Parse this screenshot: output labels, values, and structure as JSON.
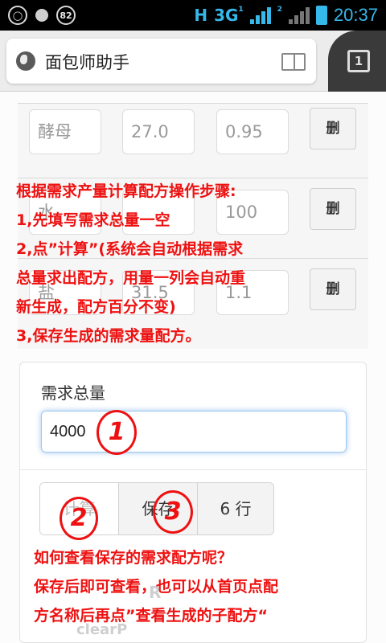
{
  "status_bar": {
    "left_badge": "82",
    "network_h": "H",
    "network_3g": "3G",
    "sim1": "1",
    "sim2": "2",
    "time": "20:37"
  },
  "browser": {
    "title": "面包师助手",
    "tab_count": "1"
  },
  "ingredients": [
    {
      "name": "酵母",
      "amount": "27.0",
      "percent": "0.95",
      "delete_label": "删"
    },
    {
      "name": "水",
      "amount": "",
      "percent": "100",
      "delete_label": "删"
    },
    {
      "name": "盐",
      "amount": "31.5",
      "percent": "1.1",
      "delete_label": "删"
    }
  ],
  "total": {
    "label": "需求总量",
    "value": "4000"
  },
  "buttons": {
    "calc": "计算",
    "save": "保存",
    "rows": "6 行"
  },
  "faded": {
    "line1": "R",
    "line2": "clearP"
  },
  "annotations": {
    "steps": [
      "根据需求产量计算配方操作步骤:",
      "1,先填写需求总量一空",
      "2,点”计算”(系统会自动根据需求",
      "总量求出配方，用量一列会自动重",
      "新生成，配方百分不变)",
      "3,保存生成的需求量配方。"
    ],
    "faq": [
      "如何查看保存的需求配方呢？",
      "保存后即可查看，也可以从首页点配",
      "方名称后再点”查看生成的子配方“"
    ],
    "marks": [
      "1",
      "2",
      "3"
    ]
  }
}
